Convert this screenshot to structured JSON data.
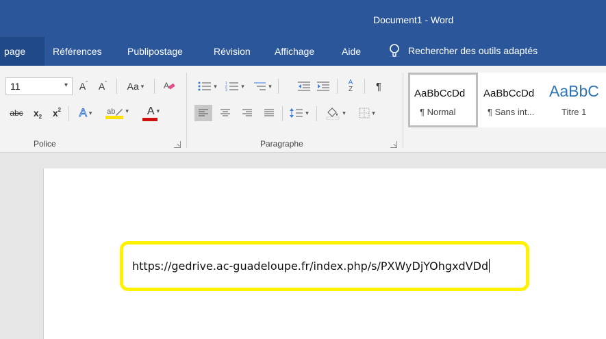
{
  "window": {
    "title": "Document1  -  Word"
  },
  "tabs": [
    {
      "label": "page",
      "partial": true
    },
    {
      "label": "Références"
    },
    {
      "label": "Publipostage"
    },
    {
      "label": "Révision"
    },
    {
      "label": "Affichage"
    },
    {
      "label": "Aide"
    }
  ],
  "search": {
    "label": "Rechercher des outils adaptés",
    "icon": "lightbulb-icon"
  },
  "ribbon": {
    "font_group": {
      "label": "Police",
      "font_size": "11",
      "buttons": {
        "grow": "A",
        "shrink": "A",
        "change_case": "Aa",
        "strikethrough": "abc",
        "subscript": "x",
        "subscript_mark": "2",
        "superscript": "x",
        "superscript_mark": "2",
        "text_effects": "A",
        "highlight": "ab",
        "font_color": "A"
      }
    },
    "paragraph_group": {
      "label": "Paragraphe",
      "sort": "A",
      "sort_sub": "Z",
      "pilcrow": "¶"
    },
    "styles": [
      {
        "sample": "AaBbCcDd",
        "name": "¶ Normal",
        "selected": true
      },
      {
        "sample": "AaBbCcDd",
        "name": "¶ Sans int..."
      },
      {
        "sample": "AaBbC",
        "name": "Titre 1"
      }
    ]
  },
  "document": {
    "text": "https://gedrive.ac-guadeloupe.fr/index.php/s/PXWyDjYOhgxdVDd",
    "highlight_color": "#fff200"
  },
  "colors": {
    "word_blue": "#2b579a",
    "ribbon_bg": "#f3f3f3",
    "highlight_yellow": "#ffe100",
    "font_red": "#d01010"
  }
}
